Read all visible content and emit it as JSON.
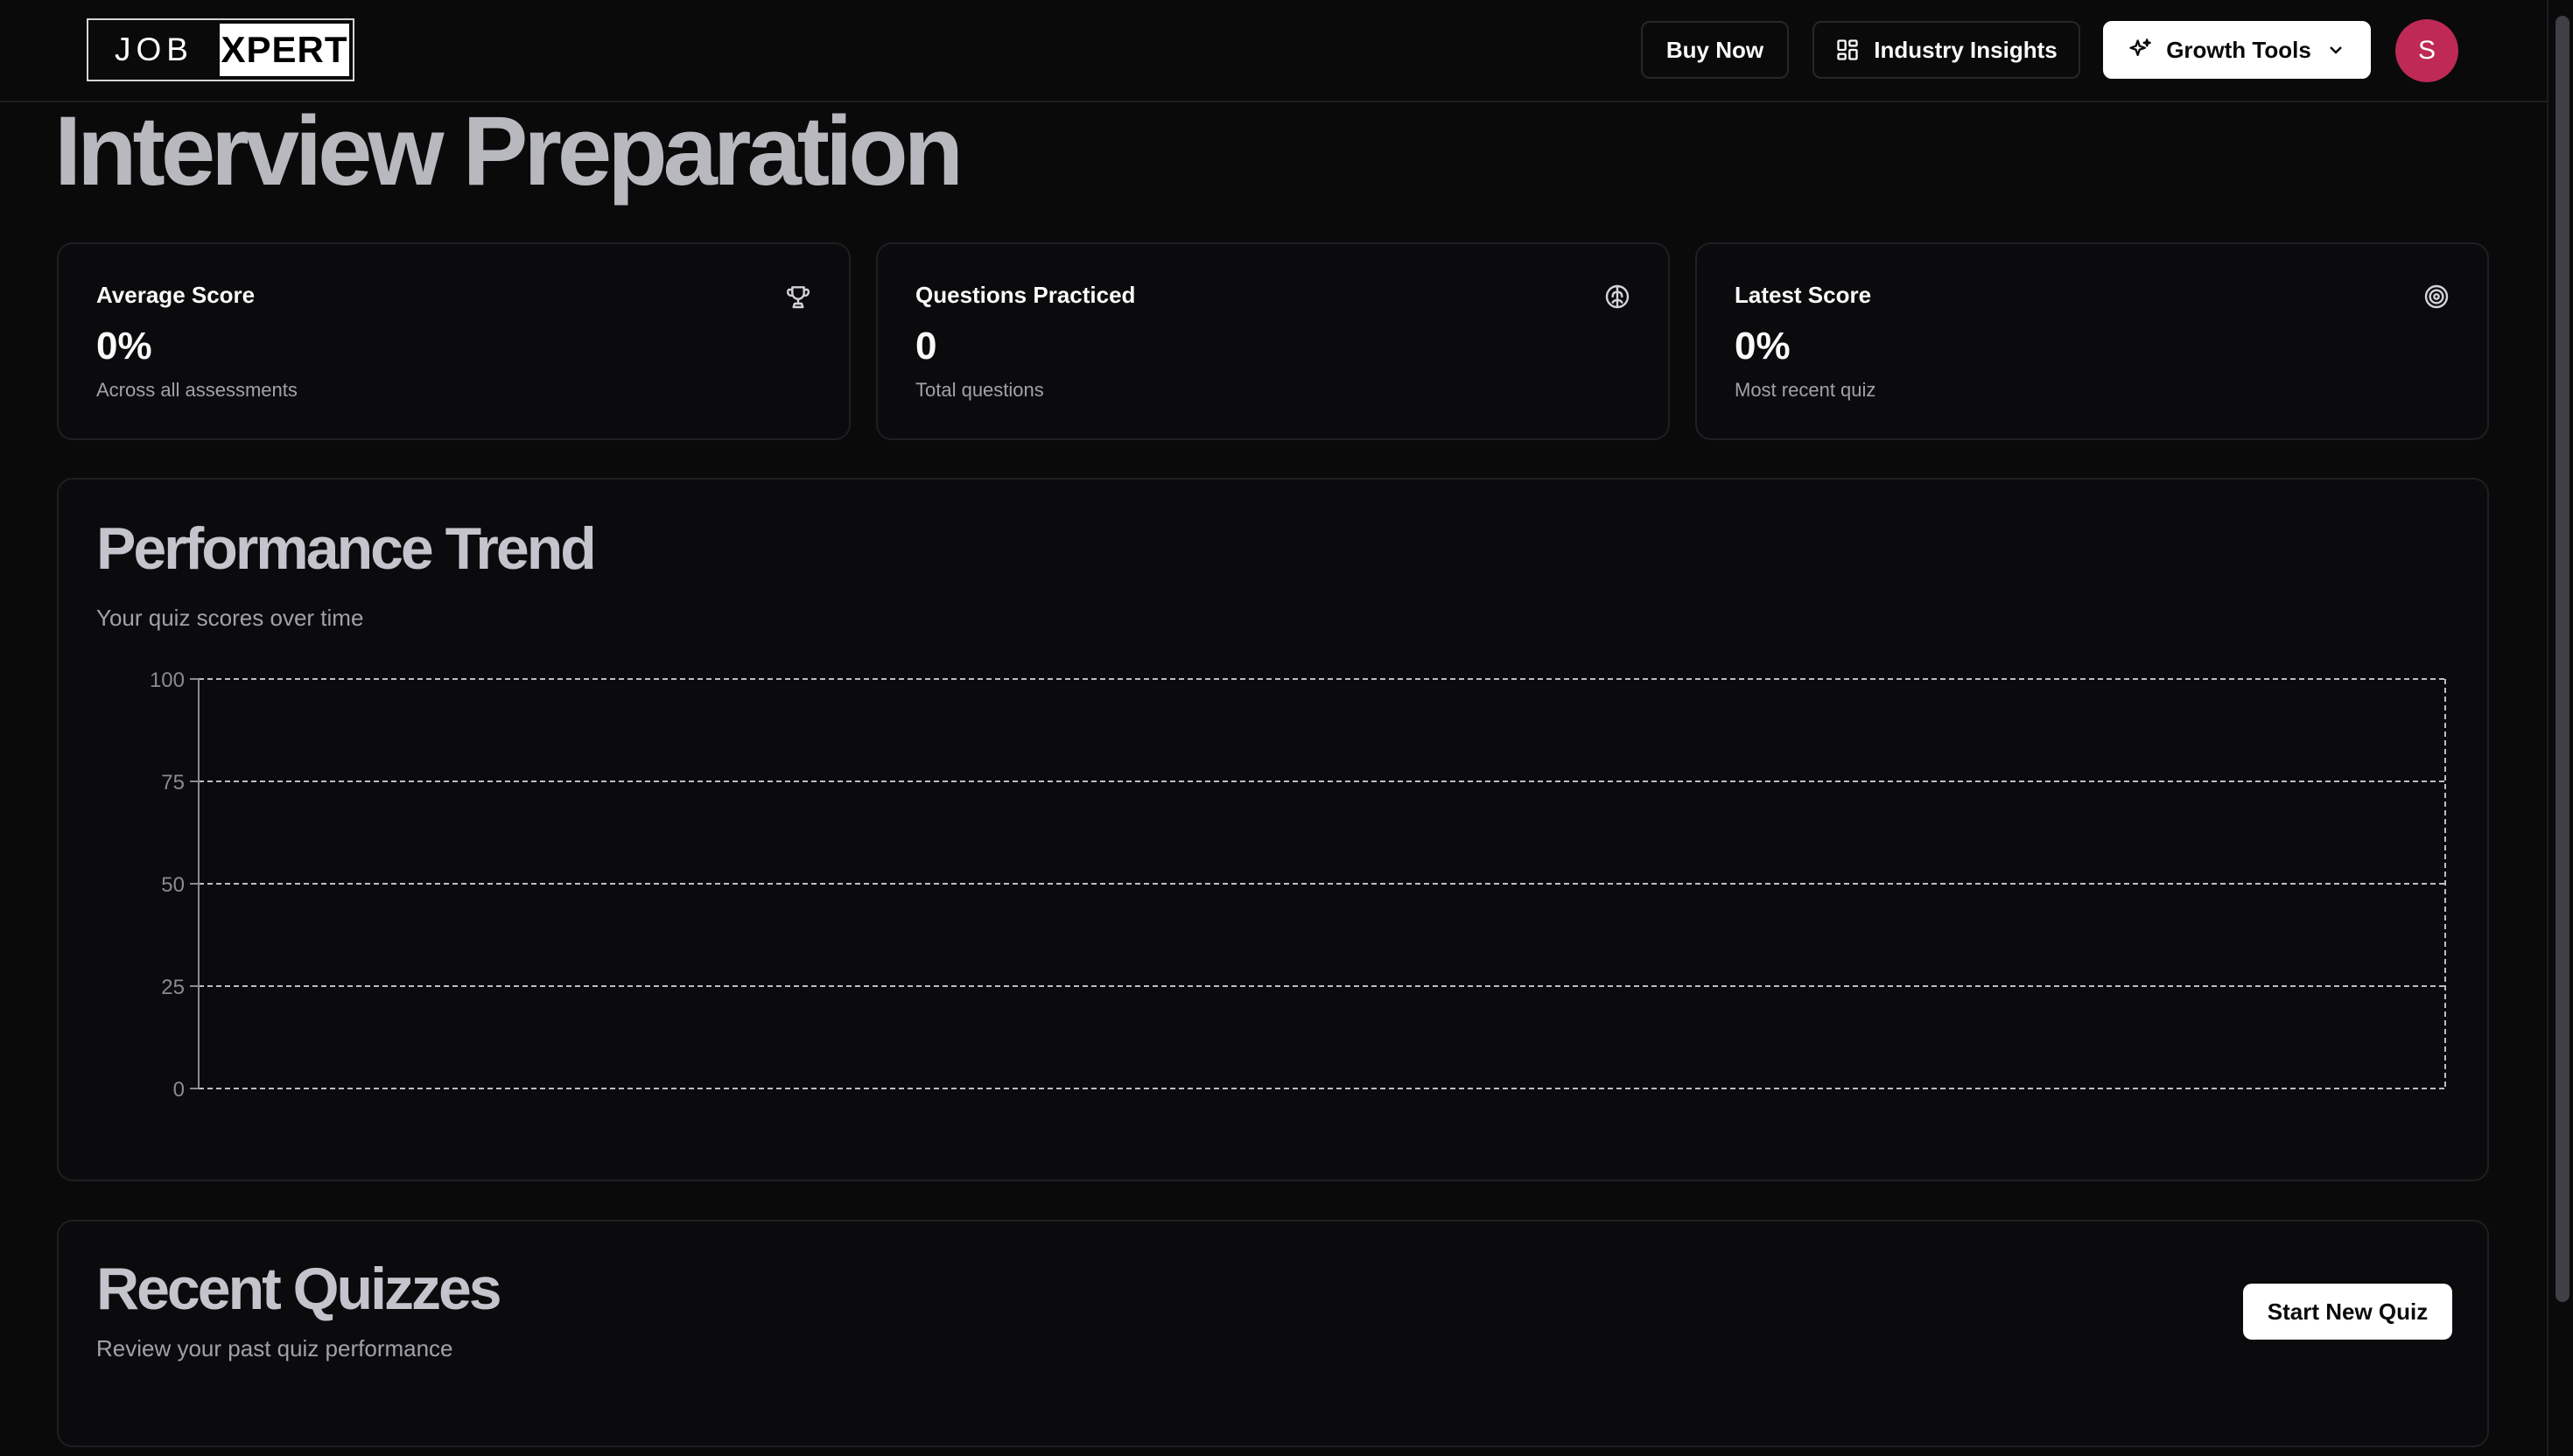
{
  "header": {
    "logo_left": "JOB",
    "logo_right": "XPERT",
    "buy_now": "Buy Now",
    "industry_insights": "Industry Insights",
    "growth_tools": "Growth Tools",
    "avatar_initial": "S"
  },
  "page": {
    "title": "Interview Preparation"
  },
  "stats": [
    {
      "label": "Average Score",
      "value": "0%",
      "sub": "Across all assessments",
      "icon": "trophy-icon"
    },
    {
      "label": "Questions Practiced",
      "value": "0",
      "sub": "Total questions",
      "icon": "brain-icon"
    },
    {
      "label": "Latest Score",
      "value": "0%",
      "sub": "Most recent quiz",
      "icon": "target-icon"
    }
  ],
  "performance": {
    "title": "Performance Trend",
    "subtitle": "Your quiz scores over time"
  },
  "chart_data": {
    "type": "line",
    "title": "",
    "xlabel": "",
    "ylabel": "",
    "x": [],
    "series": [],
    "ylim": [
      0,
      100
    ],
    "yticks": [
      "100",
      "75",
      "50",
      "25",
      "0"
    ],
    "grid": true
  },
  "recent": {
    "title": "Recent Quizzes",
    "subtitle": "Review your past quiz performance",
    "start_button": "Start New Quiz"
  },
  "colors": {
    "background": "#0a0a0b",
    "avatar": "#be2a55",
    "muted_text": "#a1a1aa"
  }
}
